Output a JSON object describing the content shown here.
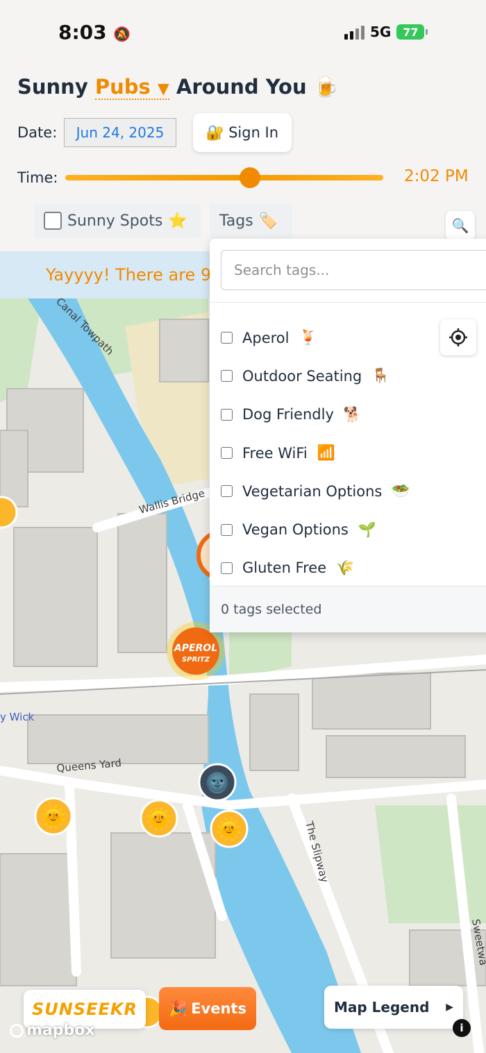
{
  "status_bar": {
    "time": "8:03",
    "mute_icon": "bell-slash-icon",
    "network": "5G",
    "battery": "77"
  },
  "header": {
    "title_prefix": "Sunny",
    "venue_type": "Pubs",
    "title_suffix": "Around You",
    "title_emoji": "🍺",
    "dropdown_arrow": "▼"
  },
  "date": {
    "label": "Date:",
    "value": "Jun 24, 2025"
  },
  "auth": {
    "icon": "🔐",
    "sign_in_label": "Sign In"
  },
  "time": {
    "label": "Time:",
    "value": "2:02 PM",
    "slider_level_percent": 58
  },
  "filters": {
    "sunny_spots_label": "Sunny Spots",
    "sunny_spots_emoji": "⭐",
    "tags_label": "Tags",
    "tags_emoji": "🏷️",
    "search_icon": "magnifying-glass-icon"
  },
  "banner": {
    "text": "Yayyyy! There are 9"
  },
  "tags_dropdown": {
    "search_placeholder": "Search tags...",
    "tags": [
      {
        "label": "Aperol",
        "emoji": "🍹"
      },
      {
        "label": "Outdoor Seating",
        "emoji": "🪑"
      },
      {
        "label": "Dog Friendly",
        "emoji": "🐕"
      },
      {
        "label": "Free WiFi",
        "emoji": "📶"
      },
      {
        "label": "Vegetarian Options",
        "emoji": "🥗"
      },
      {
        "label": "Vegan Options",
        "emoji": "🌱"
      },
      {
        "label": "Gluten Free",
        "emoji": "🌾"
      }
    ],
    "footer": "0 tags selected"
  },
  "map": {
    "street_labels": [
      "Canal Towpath",
      "Wallis Bridge",
      "Queens Yard",
      "The Slipway",
      "Sweetwa",
      "y Wick"
    ],
    "marker_badge": {
      "line1": "APEROL",
      "line2": "SPRITZ"
    },
    "sun_marker_emoji": "🌞",
    "moon_marker_emoji": "🌚",
    "colors": {
      "water": "#7cc8ec",
      "park": "#cfe6c4",
      "building": "#d9d8d3",
      "road": "#ffffff"
    }
  },
  "bottom": {
    "brand": "SUNSEEKR",
    "events_emoji": "🎉",
    "events_label": "Events",
    "legend_label": "Map Legend",
    "legend_arrow": "▶",
    "attribution": "mapbox",
    "info_symbol": "i"
  }
}
